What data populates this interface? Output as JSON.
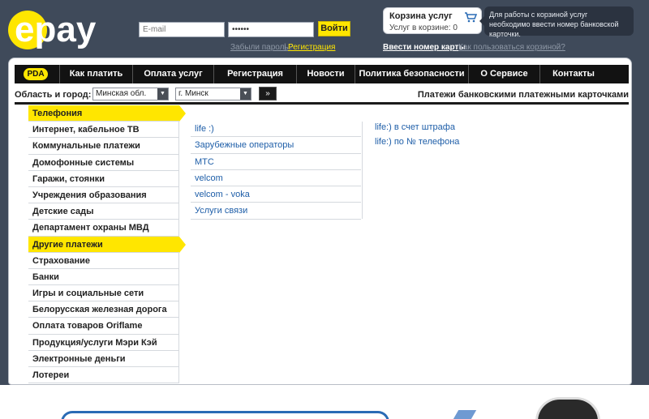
{
  "header": {
    "logo_text": "epay",
    "email_placeholder": "E-mail",
    "password_value": "••••••",
    "login_button": "Войти",
    "forgot_link": "Забыли пароль?",
    "separator": "|",
    "register_link": "Регистрация",
    "cart_title": "Корзина услуг",
    "cart_count": "Услуг в корзине: 0",
    "cart_hint": "Для работы с корзиной услуг необходимо ввести номер банковской карточки.",
    "enter_card_link": "Ввести номер карты",
    "how_cart_link": "Как пользоваться корзиной?"
  },
  "nav": {
    "pda": "PDA",
    "items": [
      "Как платить",
      "Оплата услуг",
      "Регистрация",
      "Новости",
      "Политика безопасности",
      "О Сервисе",
      "Контакты"
    ]
  },
  "region": {
    "label": "Область и город:",
    "region_value": "Минская обл.",
    "city_value": "г. Минск",
    "go_button": "»",
    "right_text": "Платежи банковскими платежными карточками"
  },
  "categories": [
    "Телефония",
    "Интернет, кабельное ТВ",
    "Коммунальные платежи",
    "Домофонные системы",
    "Гаражи, стоянки",
    "Учреждения образования",
    "Детские сады",
    "Департамент охраны МВД",
    "Другие платежи",
    "Страхование",
    "Банки",
    "Игры и социальные сети",
    "Белорусская железная дорога",
    "Оплата товаров Oriflame",
    "Продукция/услуги Мэри Кэй",
    "Электронные деньги",
    "Лотереи"
  ],
  "active_categories": [
    "Телефония",
    "Другие платежи"
  ],
  "subcategories": [
    "life :)",
    "Зарубежные операторы",
    "МТС",
    "velcom",
    "velcom - voka",
    "Услуги связи"
  ],
  "sub_subcategories": [
    "life:) в счет штрафа",
    "life:) по № телефона"
  ],
  "colors": {
    "accent": "#ffe600",
    "header_bg": "#3f4a5a",
    "link": "#1e5ea8",
    "navbar": "#121212"
  }
}
